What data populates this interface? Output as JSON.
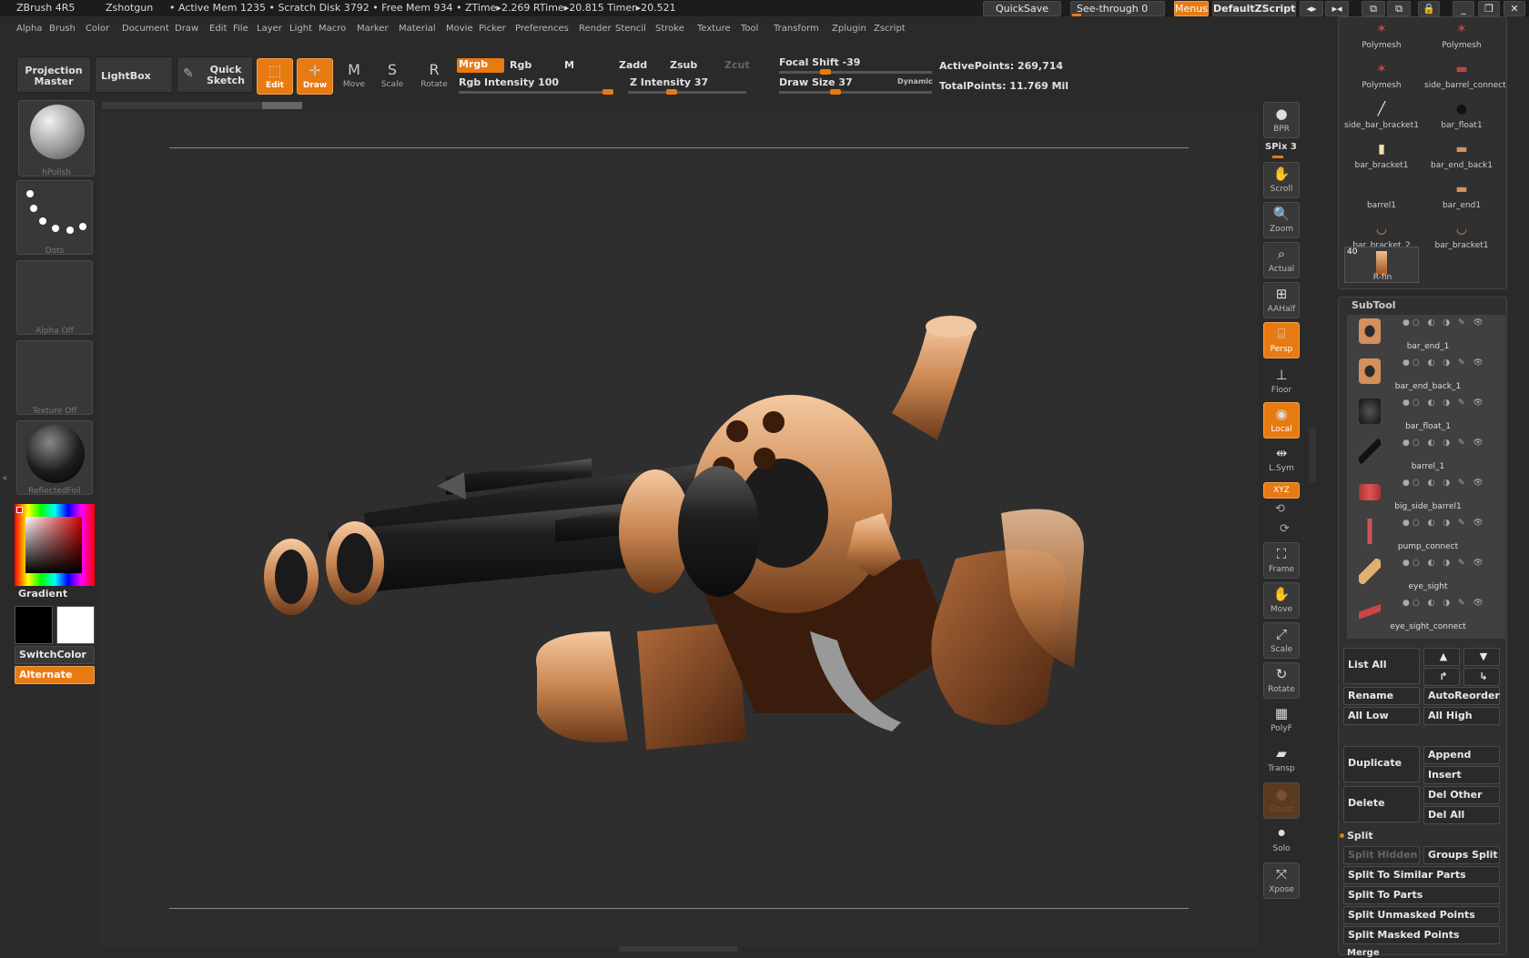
{
  "titlebar": {
    "app": "ZBrush 4R5",
    "doc": "Zshotgun",
    "stats": "• Active Mem 1235 • Scratch Disk 3792 • Free Mem 934 • ZTime▸2.269 RTime▸20.815 Timer▸20.521",
    "quicksave": "QuickSave",
    "seethrough": "See-through  0",
    "menus": "Menus",
    "script": "DefaultZScript"
  },
  "menu": [
    "Alpha",
    "Brush",
    "Color",
    "Document",
    "Draw",
    "Edit",
    "File",
    "Layer",
    "Light",
    "Macro",
    "Marker",
    "Material",
    "Movie",
    "Picker",
    "Preferences",
    "Render",
    "Stencil",
    "Stroke",
    "Texture",
    "Tool",
    "Transform",
    "Zplugin",
    "Zscript"
  ],
  "toolbar": {
    "projection_master": "Projection Master",
    "lightbox": "LightBox",
    "quick_sketch": "Quick Sketch",
    "edit": "Edit",
    "draw": "Draw",
    "move": "Move",
    "scale": "Scale",
    "rotate": "Rotate",
    "mrgb": "Mrgb",
    "rgb": "Rgb",
    "m": "M",
    "zadd": "Zadd",
    "zsub": "Zsub",
    "zcut": "Zcut",
    "rgb_intensity": "Rgb Intensity 100",
    "z_intensity": "Z Intensity 37",
    "focal_shift": "Focal Shift -39",
    "draw_size": "Draw Size 37",
    "dynamic": "Dynamic",
    "active_points": "ActivePoints: 269,714",
    "total_points": "TotalPoints: 11.769 Mil"
  },
  "slider_levels": {
    "rgb_intensity": 1.0,
    "z_intensity": 0.37,
    "focal_shift": -0.39,
    "draw_size": 0.37
  },
  "left": {
    "brush": "hPolish",
    "stroke": "Dots",
    "alpha": "Alpha Off",
    "texture": "Texture Off",
    "material": "ReflectedFoil",
    "gradient": "Gradient",
    "switchcolor": "SwitchColor",
    "alternate": "Alternate"
  },
  "right_shelf": {
    "bpr": "BPR",
    "spix": "SPix 3",
    "scroll": "Scroll",
    "zoom": "Zoom",
    "actual": "Actual",
    "aahalf": "AAHalf",
    "persp": "Persp",
    "floor": "Floor",
    "local": "Local",
    "lsym": "L.Sym",
    "xyz": "XYZ",
    "frame": "Frame",
    "move": "Move",
    "scale": "Scale",
    "rotate": "Rotate",
    "polyf": "PolyF",
    "transp": "Transp",
    "ghost": "Ghost",
    "solo": "Solo",
    "xpose": "Xpose"
  },
  "tool_thumbs": [
    "Polymesh",
    "Polymesh",
    "Polymesh",
    "side_barrel_connect",
    "side_bar_bracket1",
    "bar_float1",
    "bar_bracket1",
    "bar_end_back1",
    "barrel1",
    "bar_end1",
    "bar_bracket_2",
    "bar_bracket1",
    "R-fin"
  ],
  "rfin_count": "40",
  "subtool": {
    "title": "SubTool",
    "items": [
      "bar_end_1",
      "bar_end_back_1",
      "bar_float_1",
      "barrel_1",
      "big_side_barrel1",
      "pump_connect",
      "eye_sight",
      "eye_sight_connect"
    ],
    "list_all": "List All",
    "rename": "Rename",
    "autoreorder": "AutoReorder",
    "all_low": "All Low",
    "all_high": "All High",
    "duplicate": "Duplicate",
    "append": "Append",
    "insert": "Insert",
    "delete": "Delete",
    "del_other": "Del Other",
    "del_all": "Del All",
    "split": "Split",
    "split_hidden": "Split Hidden",
    "groups_split": "Groups Split",
    "split_similar": "Split To Similar Parts",
    "split_parts": "Split To Parts",
    "split_unmasked": "Split Unmasked Points",
    "split_masked": "Split Masked Points",
    "merge": "Merge"
  },
  "colors": {
    "accent": "#e87a12",
    "bg": "#2e2e2e",
    "copper": "#d4905c"
  }
}
